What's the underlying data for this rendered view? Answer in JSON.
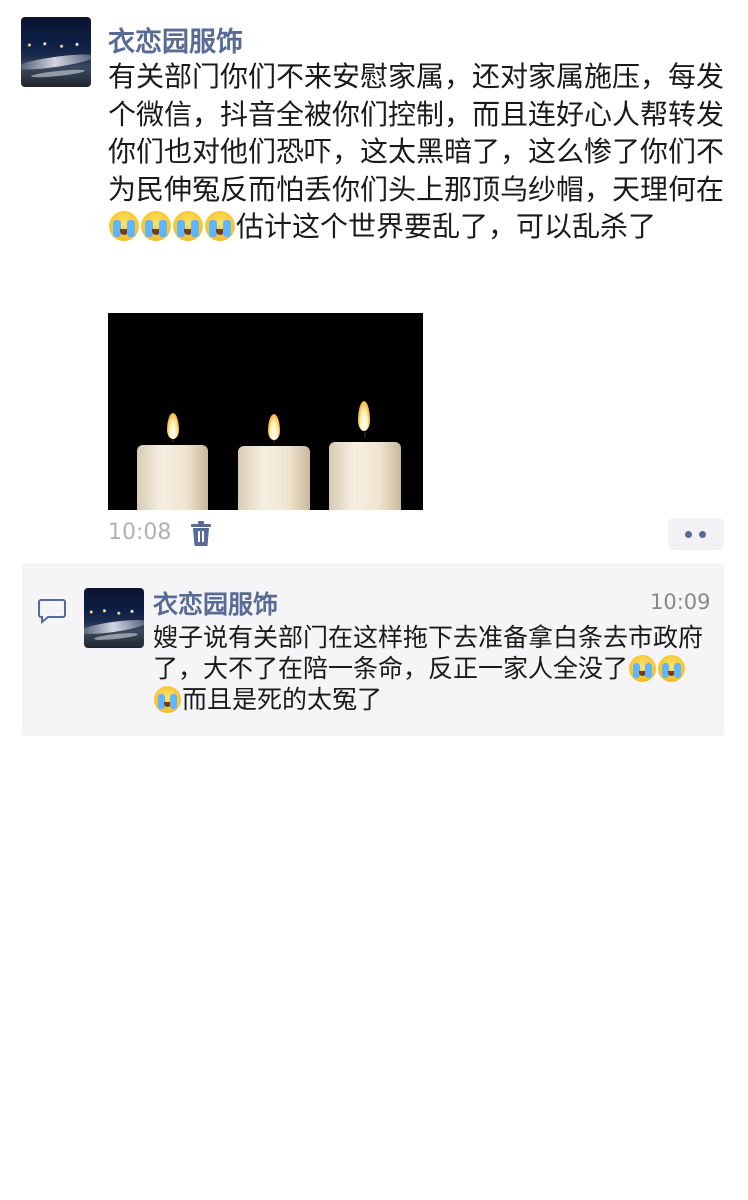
{
  "post": {
    "author": "衣恋园服饰",
    "text_before_emoji": "有关部门你们不来安慰家属，还对家属施压，每发个微信，抖音全被你们控制，而且连好心人帮转发你们也对他们恐吓，这太黑暗了，这么惨了你们不为民伸冤反而怕丢你们头上那顶乌纱帽，天理何在",
    "emoji_count": 4,
    "emoji_name": "crying-face",
    "text_after_emoji": "估计这个世界要乱了，可以乱杀了",
    "image_alt": "three lit white candles on black background",
    "time": "10:08",
    "delete_icon": "trash-icon",
    "more_icon": "more-dots-icon"
  },
  "comment": {
    "icon": "comment-icon",
    "author": "衣恋园服饰",
    "time": "10:09",
    "text_before_emoji": "嫂子说有关部门在这样拖下去准备拿白条去市政府了，大不了在陪一条命，反正一家人全没了",
    "emoji_count": 3,
    "emoji_name": "crying-face",
    "text_after_emoji": "而且是死的太冤了"
  },
  "colors": {
    "name_link": "#576b95",
    "meta_gray": "#b2b2b2",
    "comment_bg": "#f5f5f7",
    "text": "#1a1a1a"
  }
}
